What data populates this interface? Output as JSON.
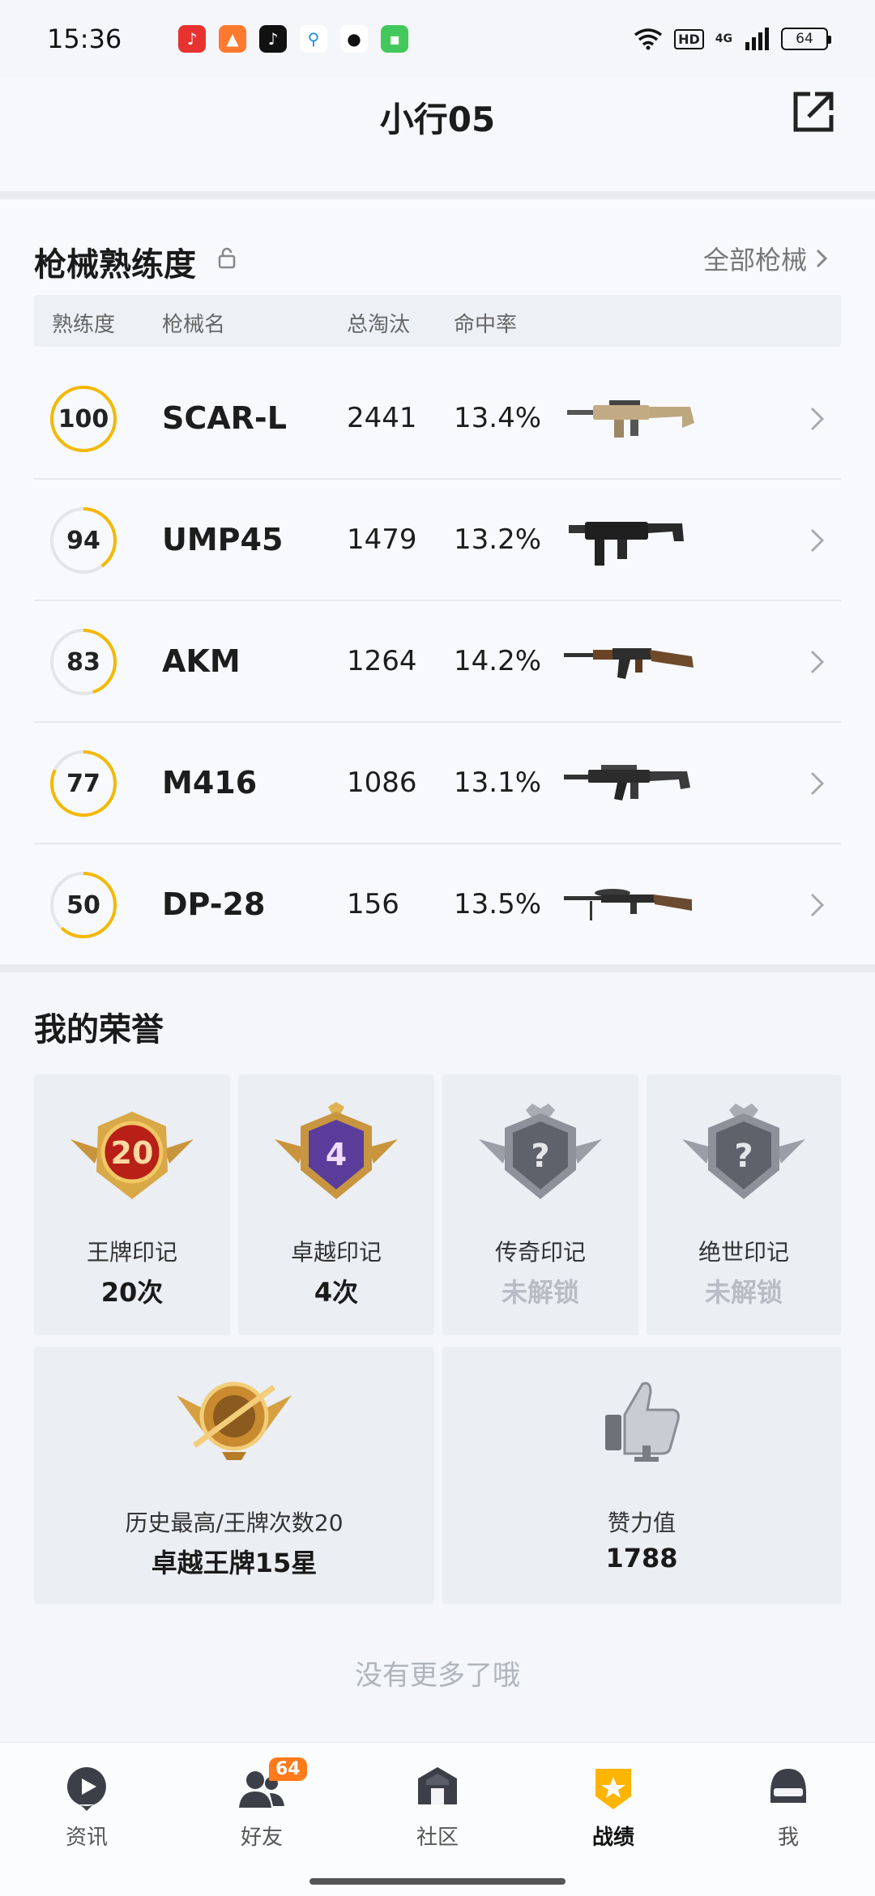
{
  "status": {
    "time": "15:36",
    "hd": "HD",
    "network": "4G",
    "battery": "64"
  },
  "header": {
    "title": "小行05"
  },
  "weapons": {
    "section_title": "枪械熟练度",
    "all_link": "全部枪械",
    "columns": {
      "level": "熟练度",
      "name": "枪械名",
      "kills": "总淘汰",
      "accuracy": "命中率"
    },
    "rows": [
      {
        "level": "100",
        "name": "SCAR-L",
        "kills": "2441",
        "accuracy": "13.4%",
        "progress": 1.0
      },
      {
        "level": "94",
        "name": "UMP45",
        "kills": "1479",
        "accuracy": "13.2%",
        "progress": 0.4
      },
      {
        "level": "83",
        "name": "AKM",
        "kills": "1264",
        "accuracy": "14.2%",
        "progress": 0.45
      },
      {
        "level": "77",
        "name": "M416",
        "kills": "1086",
        "accuracy": "13.1%",
        "progress": 0.82
      },
      {
        "level": "50",
        "name": "DP-28",
        "kills": "156",
        "accuracy": "13.5%",
        "progress": 0.62
      }
    ]
  },
  "honors": {
    "section_title": "我的荣誉",
    "cards": [
      {
        "name": "王牌印记",
        "value": "20次",
        "badge_text": "20"
      },
      {
        "name": "卓越印记",
        "value": "4次",
        "badge_text": "4"
      },
      {
        "name": "传奇印记",
        "value": "未解锁",
        "badge_text": "?"
      },
      {
        "name": "绝世印记",
        "value": "未解锁",
        "badge_text": "?"
      }
    ],
    "history": {
      "name": "历史最高/王牌次数20",
      "value": "卓越王牌15星"
    },
    "likes": {
      "name": "赞力值",
      "value": "1788"
    },
    "no_more": "没有更多了哦"
  },
  "nav": {
    "items": [
      {
        "label": "资讯"
      },
      {
        "label": "好友",
        "badge": "64"
      },
      {
        "label": "社区"
      },
      {
        "label": "战绩"
      },
      {
        "label": "我"
      }
    ]
  },
  "colors": {
    "accent": "#f5b800",
    "locked": "#b8bcc4"
  }
}
